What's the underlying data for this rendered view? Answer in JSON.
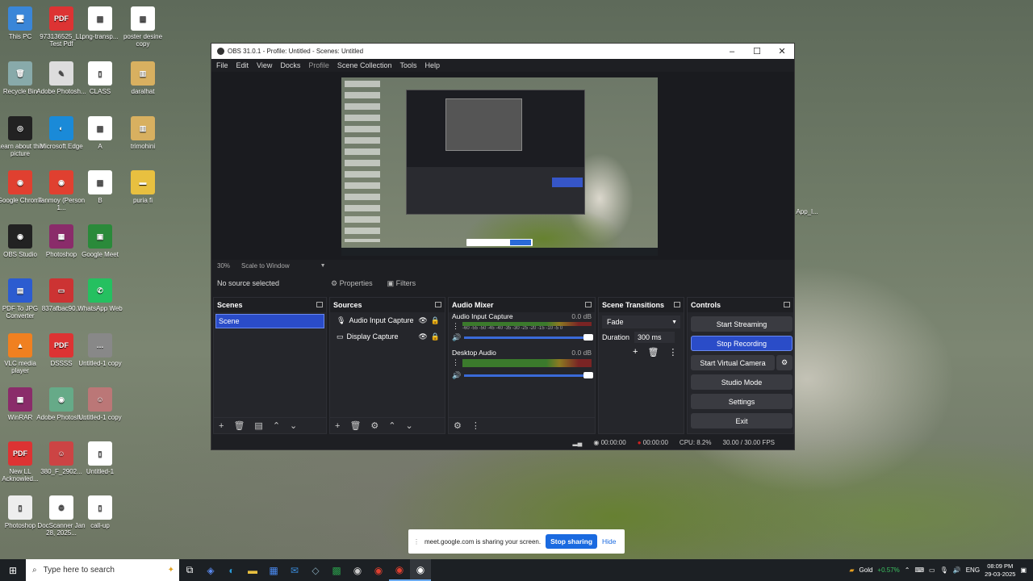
{
  "desktop_icons": [
    {
      "label": "This PC",
      "color": "#3a86d8",
      "glyph": "🖥"
    },
    {
      "label": "Recycle Bin",
      "color": "#8aa",
      "glyph": "🗑"
    },
    {
      "label": "Learn about this picture",
      "color": "#222",
      "glyph": "◎"
    },
    {
      "label": "Google Chrome",
      "color": "#e04030",
      "glyph": "◉"
    },
    {
      "label": "OBS Studio",
      "color": "#222",
      "glyph": "◉"
    },
    {
      "label": "PDF To JPG Converter",
      "color": "#2c5cd0",
      "glyph": "▤"
    },
    {
      "label": "VLC media player",
      "color": "#f08020",
      "glyph": "▲"
    },
    {
      "label": "WinRAR",
      "color": "#8a2c6a",
      "glyph": "▦"
    },
    {
      "label": "New LL Acknowled...",
      "color": "#d33",
      "glyph": "PDF"
    },
    {
      "label": "Photoshop",
      "color": "#eee",
      "glyph": "▯"
    },
    {
      "label": "973136525_LL Test Pdf",
      "color": "#d33",
      "glyph": "PDF"
    },
    {
      "label": "Adobe Photosh...",
      "color": "#ddd",
      "glyph": "✎"
    },
    {
      "label": "Microsoft Edge",
      "color": "#1a8ad8",
      "glyph": "◐"
    },
    {
      "label": "Tanmoy (Person 1...",
      "color": "#e04030",
      "glyph": "◉"
    },
    {
      "label": "Photoshop",
      "color": "#8a2c6a",
      "glyph": "▦"
    },
    {
      "label": "837afbac90...",
      "color": "#c33",
      "glyph": "▭"
    },
    {
      "label": "DSSSS",
      "color": "#d33",
      "glyph": "PDF"
    },
    {
      "label": "Adobe Photosh...",
      "color": "#6a8",
      "glyph": "◉"
    },
    {
      "label": "380_F_2902...",
      "color": "#c44",
      "glyph": "☺"
    },
    {
      "label": "DocScanner Jan 28, 2025...",
      "color": "#fff",
      "glyph": "⚙"
    },
    {
      "label": "png-transp...",
      "color": "#fff",
      "glyph": "▤"
    },
    {
      "label": "CLASS",
      "color": "#fff",
      "glyph": "▯"
    },
    {
      "label": "A",
      "color": "#fff",
      "glyph": "▤"
    },
    {
      "label": "B",
      "color": "#fff",
      "glyph": "▤"
    },
    {
      "label": "Google Meet",
      "color": "#2a8a3a",
      "glyph": "▣"
    },
    {
      "label": "WhatsApp Web",
      "color": "#25c060",
      "glyph": "✆"
    },
    {
      "label": "Untitled-1 copy",
      "color": "#888",
      "glyph": "…"
    },
    {
      "label": "Untitled-1 copy",
      "color": "#b77",
      "glyph": "☺"
    },
    {
      "label": "Untitled-1",
      "color": "#fff",
      "glyph": "▯"
    },
    {
      "label": "call-up",
      "color": "#fff",
      "glyph": "▯"
    },
    {
      "label": "poster desine copy",
      "color": "#fff",
      "glyph": "▣"
    },
    {
      "label": "daralhat",
      "color": "#d8b060",
      "glyph": "▥"
    },
    {
      "label": "trimohini",
      "color": "#d8b060",
      "glyph": "▥"
    },
    {
      "label": "puria fi",
      "color": "#e8c040",
      "glyph": "▬"
    },
    {
      "label": "App_l...",
      "color": "transparent",
      "glyph": ""
    }
  ],
  "obs": {
    "title": "OBS 31.0.1 - Profile: Untitled - Scenes: Untitled",
    "menu": [
      "File",
      "Edit",
      "View",
      "Docks",
      "Profile",
      "Scene Collection",
      "Tools",
      "Help"
    ],
    "zoom": "30%",
    "scale": "Scale to Window",
    "no_source": "No source selected",
    "properties": "Properties",
    "filters": "Filters",
    "scenes": {
      "title": "Scenes",
      "items": [
        "Scene"
      ]
    },
    "sources": {
      "title": "Sources",
      "items": [
        "Audio Input Capture",
        "Display Capture"
      ]
    },
    "mixer": {
      "title": "Audio Mixer",
      "channels": [
        {
          "name": "Audio Input Capture",
          "level": "0.0 dB"
        },
        {
          "name": "Desktop Audio",
          "level": "0.0 dB"
        }
      ],
      "ticks": "-60 -55 -50 -45 -40 -35 -30 -25 -20 -15 -10 -5 0"
    },
    "transitions": {
      "title": "Scene Transitions",
      "selected": "Fade",
      "duration_label": "Duration",
      "duration_value": "300 ms"
    },
    "controls": {
      "title": "Controls",
      "start_streaming": "Start Streaming",
      "stop_recording": "Stop Recording",
      "start_virtual_camera": "Start Virtual Camera",
      "studio_mode": "Studio Mode",
      "settings": "Settings",
      "exit": "Exit"
    },
    "status": {
      "stream_time": "00:00:00",
      "rec_time": "00:00:00",
      "cpu": "CPU: 8.2%",
      "fps": "30.00 / 30.00 FPS"
    }
  },
  "share_bar": {
    "text": "meet.google.com is sharing your screen.",
    "stop": "Stop sharing",
    "hide": "Hide"
  },
  "taskbar": {
    "search_placeholder": "Type here to search",
    "stock_name": "Gold",
    "stock_change": "+0.57%",
    "lang": "ENG",
    "time": "08:09 PM",
    "date": "29-03-2025"
  },
  "colors": {
    "accent": "#2a4cc8",
    "rec": "#d02020",
    "stock": "#3cc060"
  }
}
